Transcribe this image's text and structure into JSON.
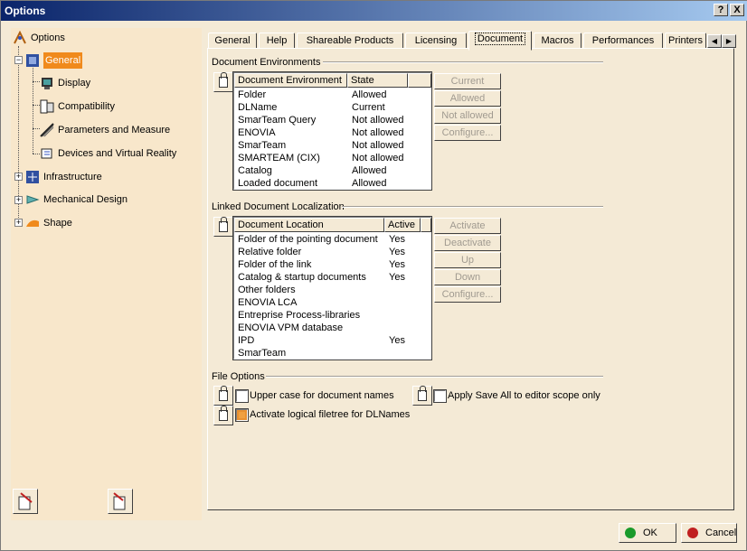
{
  "window": {
    "title": "Options",
    "help_btn": "?",
    "close_btn": "X"
  },
  "tree": {
    "root": "Options",
    "items": [
      {
        "label": "General",
        "selected": true
      },
      {
        "label": "Display"
      },
      {
        "label": "Compatibility"
      },
      {
        "label": "Parameters and Measure"
      },
      {
        "label": "Devices and Virtual Reality"
      },
      {
        "label": "Infrastructure"
      },
      {
        "label": "Mechanical Design"
      },
      {
        "label": "Shape"
      }
    ]
  },
  "tabs": [
    "General",
    "Help",
    "Shareable Products",
    "Licensing",
    "Document",
    "Macros",
    "Performances",
    "Printers"
  ],
  "active_tab": "Document",
  "doc_env": {
    "title": "Document Environments",
    "col1": "Document Environment",
    "col2": "State",
    "rows": [
      [
        "Folder",
        "Allowed"
      ],
      [
        "DLName",
        "Current"
      ],
      [
        "SmarTeam Query",
        "Not allowed"
      ],
      [
        "ENOVIA",
        "Not allowed"
      ],
      [
        "SmarTeam",
        "Not allowed"
      ],
      [
        "SMARTEAM (CIX)",
        "Not allowed"
      ],
      [
        "Catalog",
        "Allowed"
      ],
      [
        "Loaded document",
        "Allowed"
      ]
    ],
    "buttons": [
      "Current",
      "Allowed",
      "Not allowed",
      "Configure..."
    ]
  },
  "linked": {
    "title": "Linked Document Localization",
    "col1": "Document Location",
    "col2": "Active",
    "rows": [
      [
        "Folder of the pointing document",
        "Yes"
      ],
      [
        "Relative folder",
        "Yes"
      ],
      [
        "Folder of the link",
        "Yes"
      ],
      [
        "Catalog & startup documents",
        "Yes"
      ],
      [
        "Other folders",
        ""
      ],
      [
        "ENOVIA LCA",
        ""
      ],
      [
        "Entreprise Process-libraries",
        ""
      ],
      [
        "ENOVIA VPM  database",
        ""
      ],
      [
        "IPD",
        "Yes"
      ],
      [
        "SmarTeam",
        ""
      ]
    ],
    "buttons": [
      "Activate",
      "Deactivate",
      "Up",
      "Down",
      "Configure..."
    ]
  },
  "file_options": {
    "title": "File Options",
    "upper_case": "Upper case for document names",
    "apply_save": "Apply Save All to editor scope only",
    "logical_filetree": "Activate logical filetree for DLNames"
  },
  "footer": {
    "ok": "OK",
    "cancel": "Cancel"
  },
  "colors": {
    "selection": "#f08a1c",
    "title_start": "#0a246a",
    "ok_dot": "#1a9a2a",
    "cancel_dot": "#c02020"
  }
}
